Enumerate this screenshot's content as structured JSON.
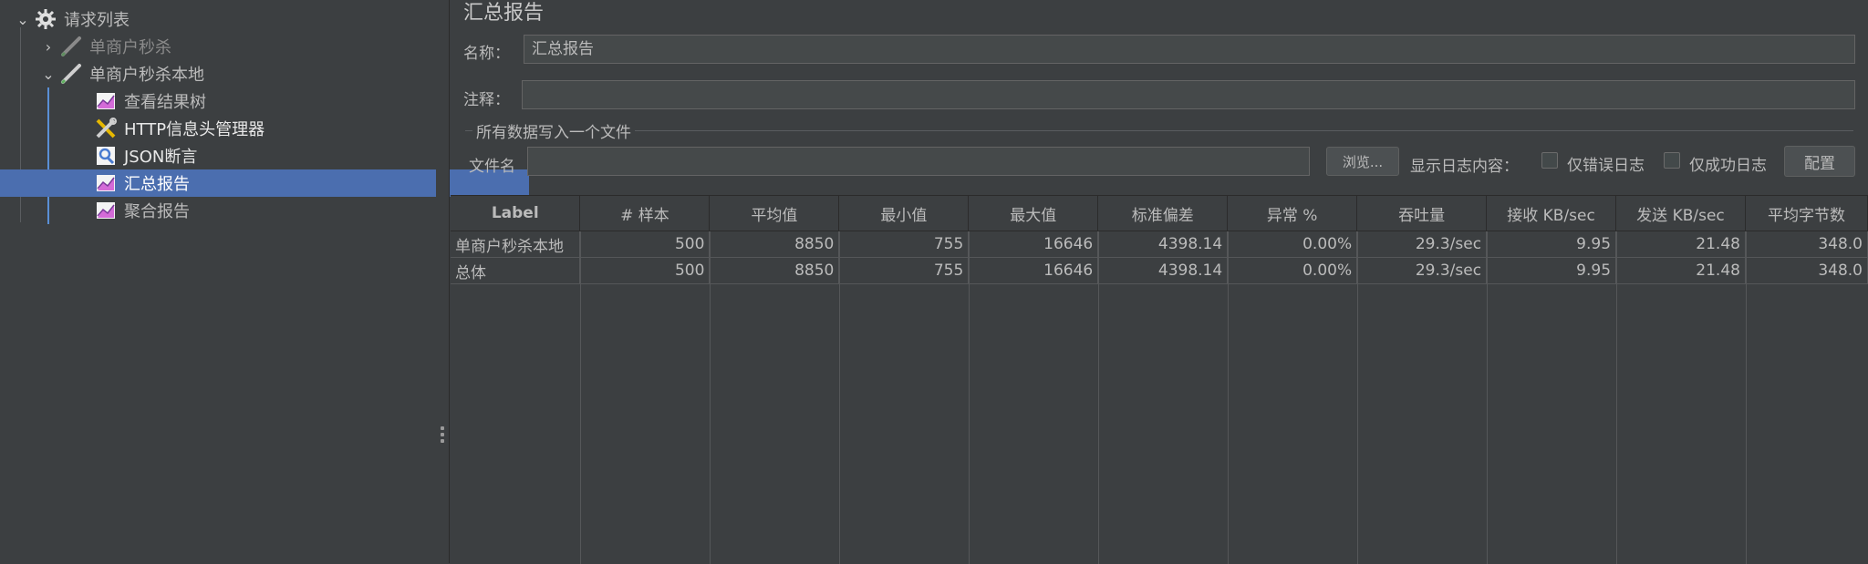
{
  "tree": {
    "items": [
      {
        "label": "请求列表",
        "icon": "gear-icon"
      },
      {
        "label": "单商户秒杀",
        "icon": "sampler-pen-icon"
      },
      {
        "label": "单商户秒杀本地",
        "icon": "sampler-pen-icon"
      },
      {
        "label": "查看结果树",
        "icon": "chart-listener-icon"
      },
      {
        "label": "HTTP信息头管理器",
        "icon": "tools-icon"
      },
      {
        "label": "JSON断言",
        "icon": "magnifier-assertion-icon"
      },
      {
        "label": "汇总报告",
        "icon": "chart-listener-icon"
      },
      {
        "label": "聚合报告",
        "icon": "chart-listener-icon"
      }
    ]
  },
  "panel": {
    "title": "汇总报告",
    "name_label": "名称：",
    "name_value": "汇总报告",
    "comment_label": "注释：",
    "comment_value": "",
    "file_group_title": "所有数据写入一个文件",
    "filename_label": "文件名",
    "filename_value": "",
    "browse_label": "浏览...",
    "log_content_label": "显示日志内容：",
    "errors_only_label": "仅错误日志",
    "success_only_label": "仅成功日志",
    "configure_label": "配置"
  },
  "table": {
    "headers": [
      "Label",
      "# 样本",
      "平均值",
      "最小值",
      "最大值",
      "标准偏差",
      "异常 %",
      "吞吐量",
      "接收 KB/sec",
      "发送 KB/sec",
      "平均字节数"
    ],
    "rows": [
      [
        "单商户秒杀本地",
        "500",
        "8850",
        "755",
        "16646",
        "4398.14",
        "0.00%",
        "29.3/sec",
        "9.95",
        "21.48",
        "348.0"
      ],
      [
        "总体",
        "500",
        "8850",
        "755",
        "16646",
        "4398.14",
        "0.00%",
        "29.3/sec",
        "9.95",
        "21.48",
        "348.0"
      ]
    ]
  },
  "colors": {
    "background": "#3c3f41",
    "selection": "#4b6eaf",
    "text": "#bbbbbb"
  }
}
